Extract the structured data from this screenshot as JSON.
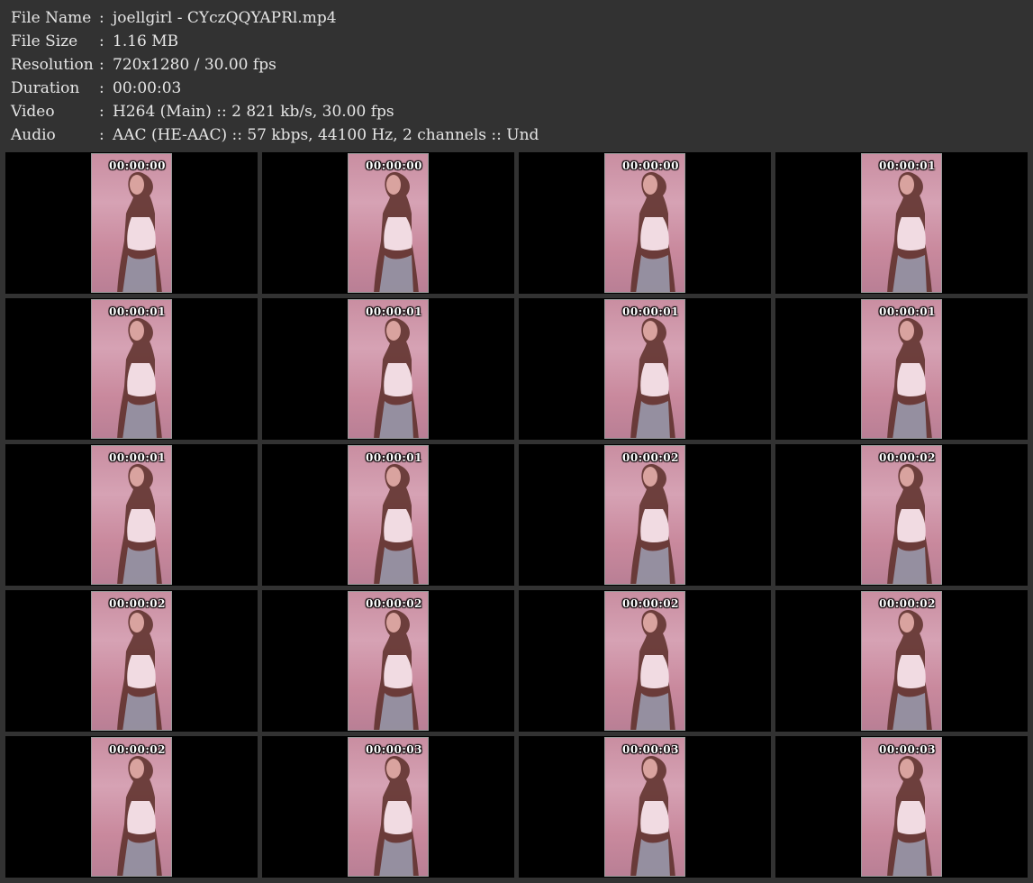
{
  "file_info": {
    "file_name": {
      "label": "File Name",
      "value": "joellgirl - CYczQQYAPRl.mp4"
    },
    "file_size": {
      "label": "File Size",
      "value": "1.16 MB"
    },
    "resolution": {
      "label": "Resolution",
      "value": "720x1280 / 30.00 fps"
    },
    "duration": {
      "label": "Duration",
      "value": "00:00:03"
    },
    "video": {
      "label": "Video",
      "value": "H264 (Main) :: 2 821 kb/s, 30.00 fps"
    },
    "audio": {
      "label": "Audio",
      "value": "AAC (HE-AAC) :: 57 kbps, 44100 Hz, 2 channels :: Und"
    }
  },
  "separator": ":",
  "thumbnails": [
    "00:00:00",
    "00:00:00",
    "00:00:00",
    "00:00:01",
    "00:00:01",
    "00:00:01",
    "00:00:01",
    "00:00:01",
    "00:00:01",
    "00:00:01",
    "00:00:02",
    "00:00:02",
    "00:00:02",
    "00:00:02",
    "00:00:02",
    "00:00:02",
    "00:00:02",
    "00:00:03",
    "00:00:03",
    "00:00:03"
  ],
  "colors": {
    "background": "#323232",
    "cell_background": "#000000",
    "thumbnail_tint": "#d6a2b4",
    "text": "#e6e6e6"
  }
}
